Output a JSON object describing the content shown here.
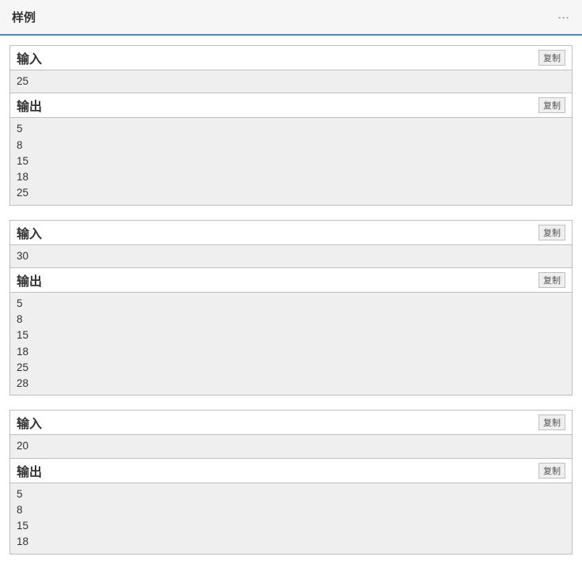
{
  "header": {
    "title": "样例"
  },
  "labels": {
    "input": "输入",
    "output": "输出",
    "copy": "复制"
  },
  "examples": [
    {
      "input": "25",
      "output": "5\n8\n15\n18\n25"
    },
    {
      "input": "30",
      "output": "5\n8\n15\n18\n25\n28"
    },
    {
      "input": "20",
      "output": "5\n8\n15\n18"
    }
  ]
}
